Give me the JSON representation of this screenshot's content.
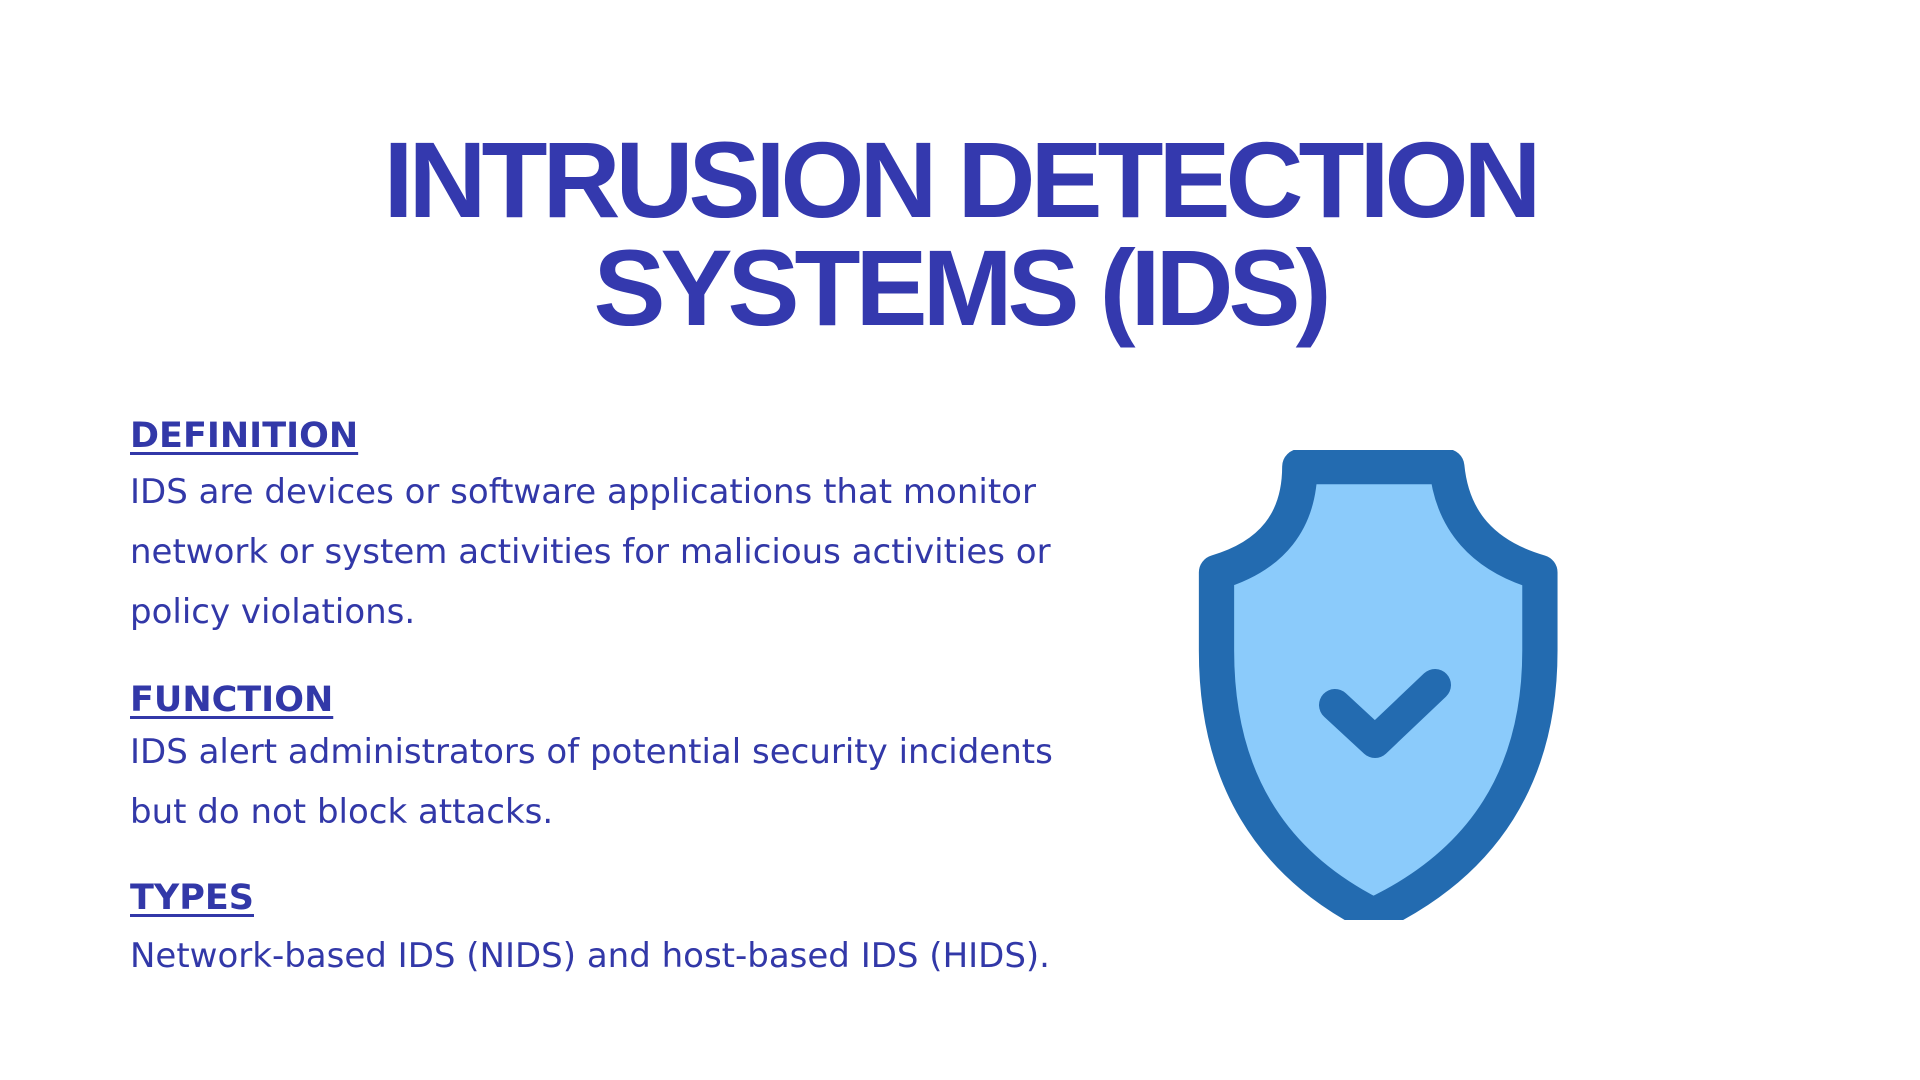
{
  "title": {
    "line1": "INTRUSION DETECTION",
    "line2": "SYSTEMS (IDS)"
  },
  "sections": [
    {
      "heading": "DEFINITION",
      "body": "IDS are devices or software applications that monitor network or system activities for malicious activities or policy violations."
    },
    {
      "heading": "FUNCTION",
      "body": "IDS alert administrators of potential security incidents but do not block attacks."
    },
    {
      "heading": "TYPES",
      "body": "Network-based IDS (NIDS) and host-based IDS (HIDS)."
    }
  ],
  "icon": {
    "name": "shield-check-icon",
    "outline_color": "#236bb0",
    "fill_color": "#8bcbfb"
  },
  "colors": {
    "text": "#3238a8",
    "title": "#3439ae",
    "background": "#ffffff"
  }
}
